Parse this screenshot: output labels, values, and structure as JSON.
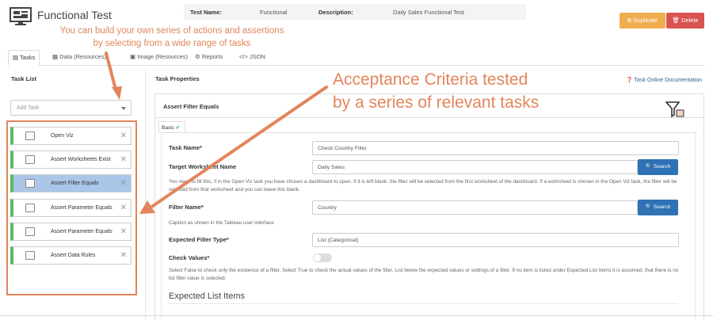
{
  "app": {
    "title": "Functional Test",
    "icon": "dashboard-icon"
  },
  "meta": {
    "test_name_label": "Test Name:",
    "test_name_value": "Functional",
    "description_label": "Description:",
    "description_value": "Daily Sales Functional Test"
  },
  "actions": {
    "duplicate_label": "Duplicate",
    "delete_label": "Delete",
    "duplicate_color": "#f0ad4e",
    "delete_color": "#d9534f"
  },
  "tabs": [
    {
      "label": "Tasks",
      "icon": "tasks-icon"
    },
    {
      "label": "Data (Resources)",
      "icon": "table-icon"
    },
    {
      "label": "Image (Resources)",
      "icon": "image-icon"
    },
    {
      "label": "Reports",
      "icon": "gear-icon"
    },
    {
      "label": "JSON",
      "icon": "code-icon"
    }
  ],
  "task_list": {
    "title": "Task List",
    "add_task_placeholder": "Add Task",
    "items": [
      {
        "label": "Open Viz",
        "icon": "viz-icon"
      },
      {
        "label": "Assert Worksheets Exist",
        "icon": "worksheets-icon"
      },
      {
        "label": "Assert Filter Equals",
        "icon": "filter-icon",
        "selected": true
      },
      {
        "label": "Assert Parameter Equals",
        "icon": "parameter-icon"
      },
      {
        "label": "Assert Parameter Equals",
        "icon": "parameter-icon"
      },
      {
        "label": "Assert Data Rules",
        "icon": "data-rules-icon"
      }
    ]
  },
  "task_properties": {
    "title": "Task Properties",
    "doc_link": "Task Online Documentation",
    "panel_title": "Assert Filter Equals",
    "subtab_label": "Basic",
    "task_name_label": "Task Name*",
    "task_name_value": "Check Country Filter",
    "target_ws_label": "Target Worksheet Name",
    "target_ws_value": "Daily Sales",
    "target_ws_help": "You need to fill this, if in the Open Viz task you have chosen a dashboard to open. If it is left blank, the filter will be selected from the first worksheet of the dashboard. If a worksheet is chosen in the Open Viz task, the filter will be selected from that worksheet and you can leave this blank.",
    "search_label": "Search",
    "filter_name_label": "Filter Name*",
    "filter_name_value": "Country",
    "filter_name_help": "Caption as shown in the Tableau user interface",
    "expected_type_label": "Expected Filter Type*",
    "expected_type_value": "List (Categorical)",
    "check_values_label": "Check Values*",
    "check_values_help": "Select False to check only the existence of a filter. Select True to check the actual values of the filter. List below the expected values or settings of a filter. If no item is listed under Expected List Items it is assumed, that there is no list filter value is selected.",
    "expected_items_heading": "Expected List Items"
  },
  "annotations": {
    "small_note": "You can build your own series of actions and assertions by selecting from a wide range of tasks",
    "big_note_line1": "Acceptance Criteria tested",
    "big_note_line2": "by a series of relevant tasks",
    "color": "#e3855b"
  }
}
